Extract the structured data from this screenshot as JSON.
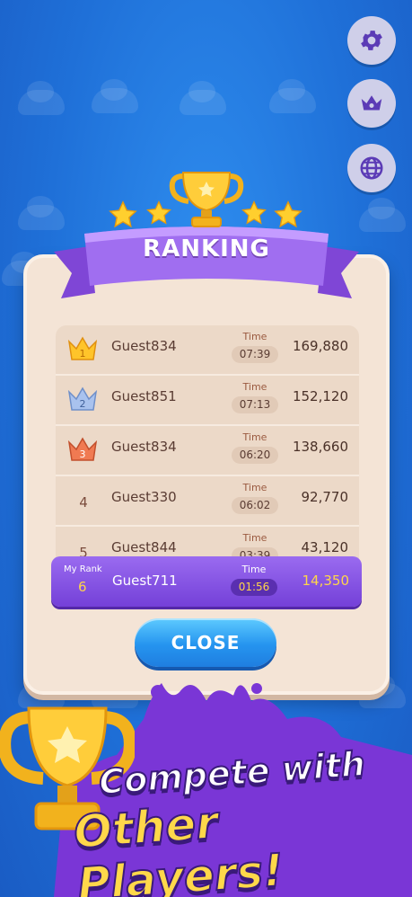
{
  "header": {
    "title": "RANKING"
  },
  "side_buttons": [
    {
      "icon": "gear-icon",
      "name": "settings-button"
    },
    {
      "icon": "crown-icon",
      "name": "ranking-button"
    },
    {
      "icon": "globe-icon",
      "name": "language-button"
    }
  ],
  "ranking": {
    "time_label": "Time",
    "rows": [
      {
        "rank": "1",
        "name": "Guest834",
        "time": "07:39",
        "score": "169,880",
        "crown": "gold"
      },
      {
        "rank": "2",
        "name": "Guest851",
        "time": "07:13",
        "score": "152,120",
        "crown": "silver"
      },
      {
        "rank": "3",
        "name": "Guest834",
        "time": "06:20",
        "score": "138,660",
        "crown": "bronze"
      },
      {
        "rank": "4",
        "name": "Guest330",
        "time": "06:02",
        "score": "92,770"
      },
      {
        "rank": "5",
        "name": "Guest844",
        "time": "03:39",
        "score": "43,120"
      }
    ],
    "my_rank": {
      "label": "My Rank",
      "rank": "6",
      "name": "Guest711",
      "time": "01:56",
      "score": "14,350"
    }
  },
  "close_label": "CLOSE",
  "promo": {
    "line1": "Compete with",
    "line2": "Other Players!"
  },
  "colors": {
    "background": "#1f70d8",
    "accent_purple": "#7a45dc",
    "gold": "#ffd54a",
    "button_blue": "#2594ef"
  }
}
